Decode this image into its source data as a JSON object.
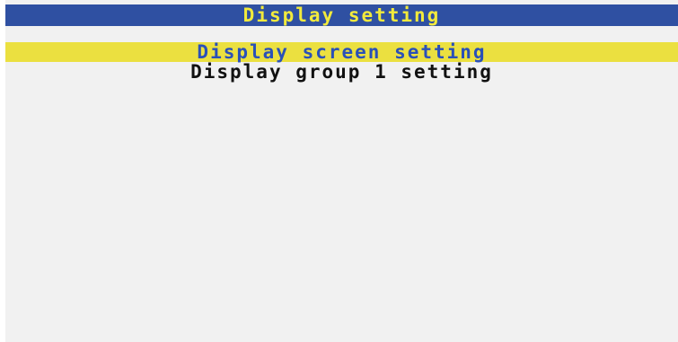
{
  "title": "Display setting",
  "menu": {
    "items": [
      {
        "label": "Display screen setting",
        "selected": true
      },
      {
        "label": "Display group 1 setting",
        "selected": false
      }
    ]
  },
  "colors": {
    "title_bar": "#2f50a2",
    "title_text": "#f2ea3c",
    "screen_bg": "#f1f1f1",
    "selection_bg": "#ebe040",
    "selected_text": "#2a50b8",
    "item_text": "#111111"
  }
}
